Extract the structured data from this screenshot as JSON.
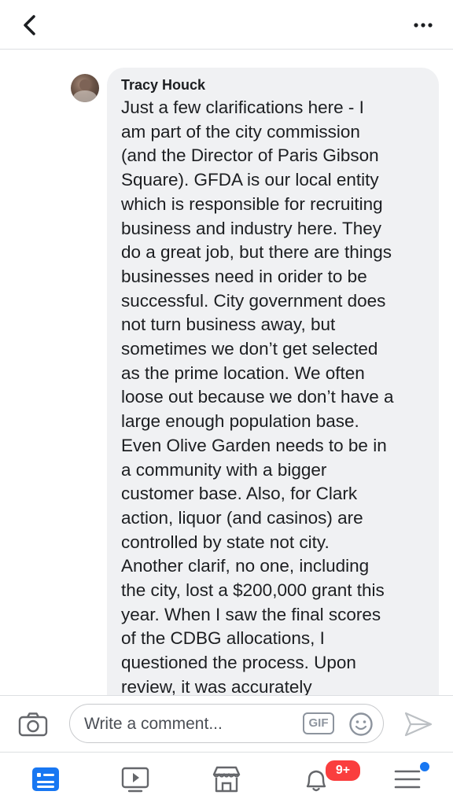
{
  "header": {
    "back_icon": "chevron-left-icon",
    "more_icon": "more-horizontal-icon"
  },
  "comment": {
    "author": "Tracy Houck",
    "lines": [
      "Just a few clarifications here - I",
      "am part of the city commission",
      "(and the Director of Paris Gibson",
      "Square). GFDA is our local entity",
      "which is responsible for recruiting",
      "business and industry here. They",
      "do a great job, but there are things",
      "businesses need in orider to be",
      "successful. City government does",
      "not turn business away, but",
      "sometimes we don’t get selected",
      "as the prime location. We often",
      "loose out because we don’t have a",
      "large enough population base.",
      "Even Olive Garden needs to be in",
      "a community with a bigger",
      "customer base. Also, for Clark",
      "action, liquor (and casinos) are",
      "controlled by state not city.",
      "Another clarif, no one, including",
      "the city, lost a $200,000 grant this",
      "year. When I saw the final scores",
      "of the CDBG allocations, I",
      "questioned the process. Upon",
      "review, it was accurately"
    ]
  },
  "composer": {
    "placeholder": "Write a comment...",
    "gif_label": "GIF"
  },
  "tabs": {
    "notifications_badge": "9+",
    "active_color": "#1877f2",
    "inactive_color": "#65676b"
  }
}
